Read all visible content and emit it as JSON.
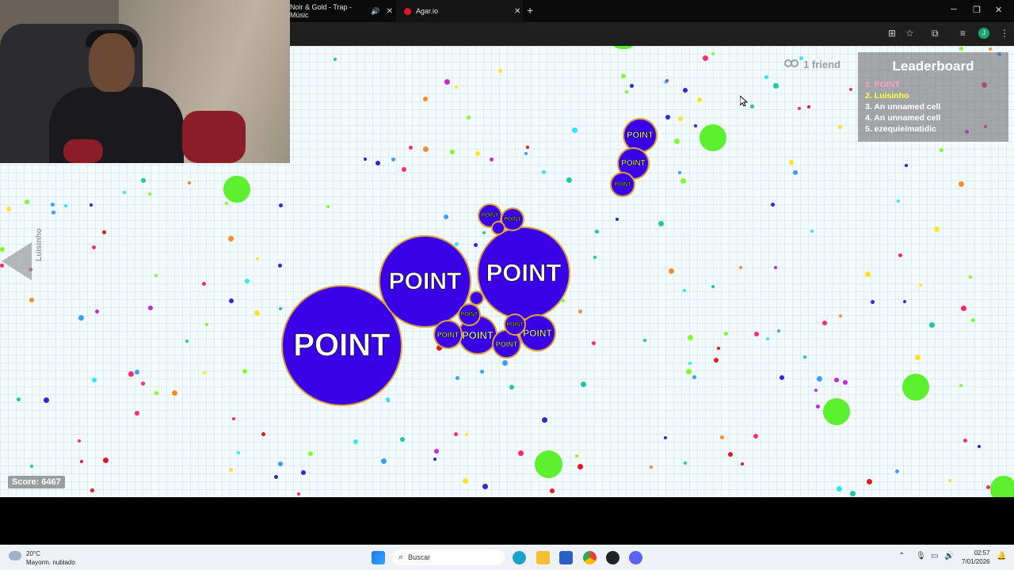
{
  "browser": {
    "tabs": [
      {
        "title": "Noir & Gold - Trap - Músic",
        "close": "✕"
      },
      {
        "title": "Agar.io",
        "close": "✕"
      }
    ],
    "new_tab": "+",
    "window_controls": [
      "─",
      "❐",
      "✕"
    ],
    "profile_initial": "J"
  },
  "game": {
    "friends_label": "1 friend",
    "leaderboard": {
      "title": "Leaderboard",
      "entries": [
        {
          "text": "1. POINT",
          "color": "#ff9ec7"
        },
        {
          "text": "2. Luisinho",
          "color": "#ffff3a"
        },
        {
          "text": "3. An unnamed cell",
          "color": "#ffffff"
        },
        {
          "text": "4. An unnamed cell",
          "color": "#ffffff"
        },
        {
          "text": "5. ezequielmatidic",
          "color": "#ffffff"
        }
      ]
    },
    "offscreen_player": "Luisinho",
    "cell_name": "POINT",
    "score_label": "Score: 6467",
    "cell_color": "#3a00e6",
    "virus_color": "#5cf02e"
  },
  "taskbar": {
    "weather_temp": "20°C",
    "weather_desc": "Mayorm. nublado",
    "search_placeholder": "Buscar",
    "time": "02:57",
    "date": "7/01/2026"
  }
}
